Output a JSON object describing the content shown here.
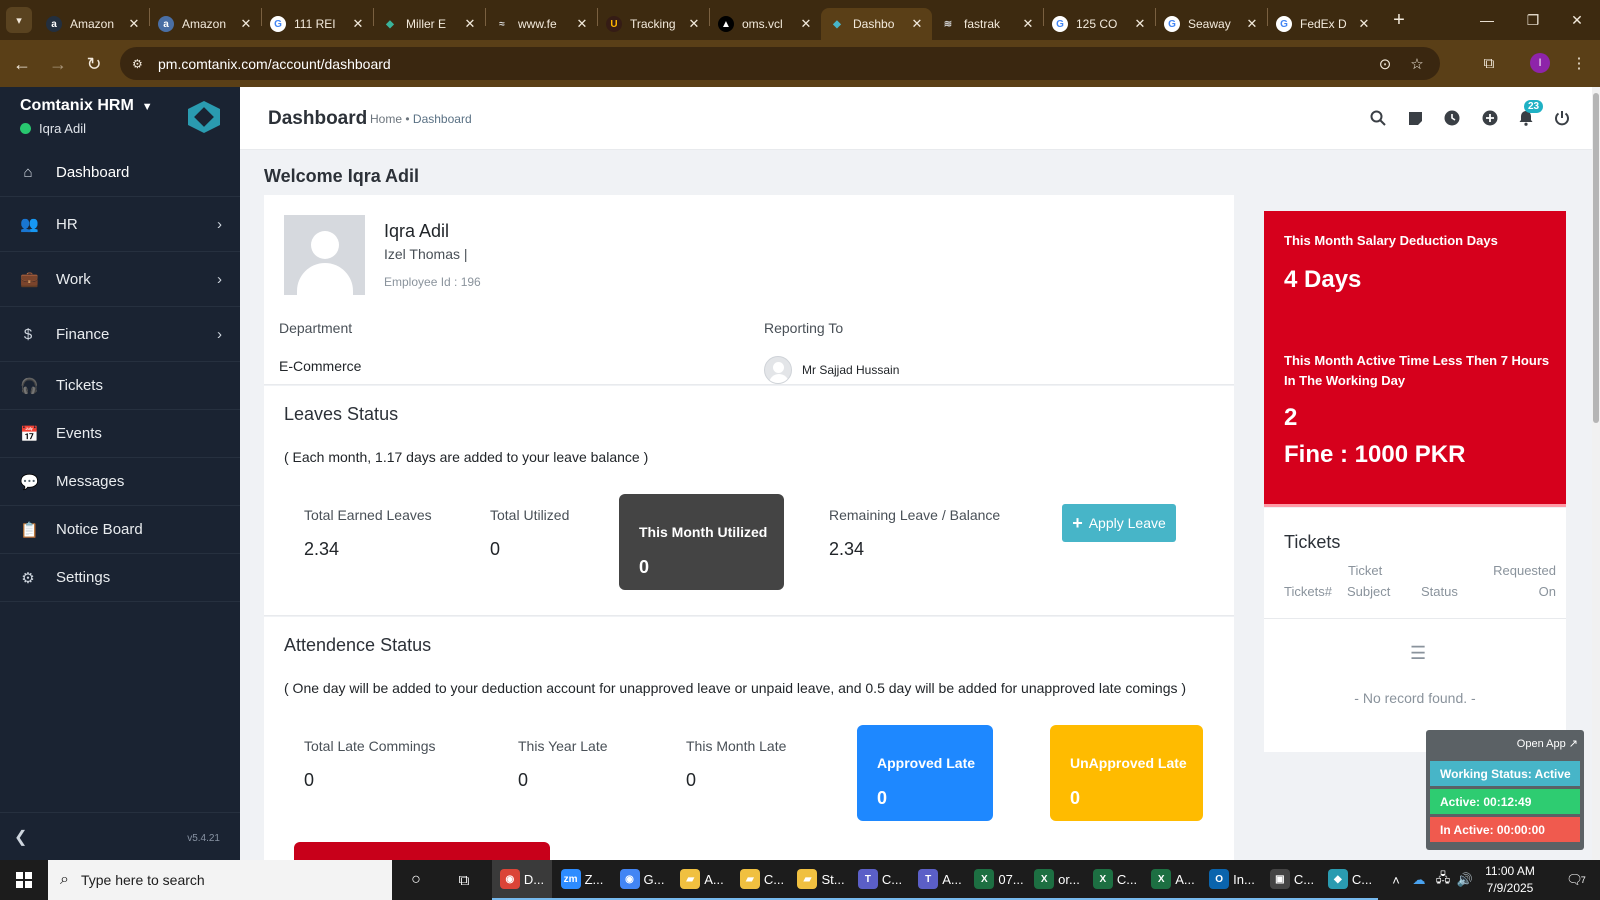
{
  "browser": {
    "tabs": [
      {
        "title": "Amazon",
        "fav": "a",
        "favcolor": "#ffffff",
        "favbg": "#232f3e"
      },
      {
        "title": "Amazon",
        "fav": "a",
        "favcolor": "#ffffff",
        "favbg": "#4a6fa5"
      },
      {
        "title": "111 REI",
        "fav": "G",
        "favcolor": "#4285f4",
        "favbg": "#ffffff"
      },
      {
        "title": "Miller E",
        "fav": "◆",
        "favcolor": "#3ab39a",
        "favbg": "transparent"
      },
      {
        "title": "www.fe",
        "fav": "≈",
        "favcolor": "#dddddd",
        "favbg": "transparent"
      },
      {
        "title": "Tracking",
        "fav": "U",
        "favcolor": "#ffb500",
        "favbg": "#351c15"
      },
      {
        "title": "oms.vcl",
        "fav": "▲",
        "favcolor": "#ffffff",
        "favbg": "#000000"
      },
      {
        "title": "Dashbo",
        "fav": "◆",
        "favcolor": "#47b5c8",
        "favbg": "transparent"
      },
      {
        "title": "fastrak",
        "fav": "≋",
        "favcolor": "#cccccc",
        "favbg": "transparent"
      },
      {
        "title": "125 CO",
        "fav": "G",
        "favcolor": "#4285f4",
        "favbg": "#ffffff"
      },
      {
        "title": "Seaway",
        "fav": "G",
        "favcolor": "#4285f4",
        "favbg": "#ffffff"
      },
      {
        "title": "FedEx D",
        "fav": "G",
        "favcolor": "#4285f4",
        "favbg": "#ffffff"
      }
    ],
    "url": "pm.comtanix.com/account/dashboard",
    "profile_initial": "I"
  },
  "sidebar": {
    "brand": "Comtanix HRM",
    "user": "Iqra Adil",
    "version": "v5.4.21",
    "items": [
      {
        "label": "Dashboard",
        "icon": "⌂",
        "name": "sidebar-item-dashboard",
        "arrow": false
      },
      {
        "label": "HR",
        "icon": "👥",
        "name": "sidebar-item-hr",
        "arrow": true
      },
      {
        "label": "Work",
        "icon": "💼",
        "name": "sidebar-item-work",
        "arrow": true
      },
      {
        "label": "Finance",
        "icon": "$",
        "name": "sidebar-item-finance",
        "arrow": true
      },
      {
        "label": "Tickets",
        "icon": "🎧",
        "name": "sidebar-item-tickets",
        "arrow": false
      },
      {
        "label": "Events",
        "icon": "📅",
        "name": "sidebar-item-events",
        "arrow": false
      },
      {
        "label": "Messages",
        "icon": "💬",
        "name": "sidebar-item-messages",
        "arrow": false
      },
      {
        "label": "Notice Board",
        "icon": "📋",
        "name": "sidebar-item-notice-board",
        "arrow": false
      },
      {
        "label": "Settings",
        "icon": "⚙",
        "name": "sidebar-item-settings",
        "arrow": false
      }
    ]
  },
  "header": {
    "title": "Dashboard",
    "breadcrumb_home": "Home",
    "breadcrumb_sep": "•",
    "breadcrumb_current": "Dashboard",
    "notification_count": "23"
  },
  "welcome": "Welcome Iqra Adil",
  "profile": {
    "name": "Iqra Adil",
    "designation": "Izel Thomas |",
    "employee_id": "Employee Id : 196",
    "department_label": "Department",
    "department": "E-Commerce",
    "reporting_label": "Reporting To",
    "reporting_to": "Mr Sajjad Hussain"
  },
  "leaves": {
    "title": "Leaves Status",
    "note": "( Each month, 1.17 days are added to your leave balance )",
    "total_earned_label": "Total Earned Leaves",
    "total_earned": "2.34",
    "total_utilized_label": "Total Utilized",
    "total_utilized": "0",
    "month_utilized_label": "This Month Utilized",
    "month_utilized": "0",
    "remaining_label": "Remaining Leave / Balance",
    "remaining": "2.34",
    "apply_label": "Apply Leave"
  },
  "attendance": {
    "title": "Attendence Status",
    "note": "( One day will be added to your deduction account for unapproved leave or unpaid leave, and 0.5 day will be added for unapproved late comings )",
    "total_late_label": "Total Late Commings",
    "total_late": "0",
    "year_late_label": "This Year Late",
    "year_late": "0",
    "month_late_label": "This Month Late",
    "month_late": "0",
    "approved_label": "Approved Late",
    "approved": "0",
    "unapproved_label": "UnApproved Late",
    "unapproved": "0"
  },
  "salary": {
    "deduction_label": "This Month Salary Deduction Days",
    "deduction_days": "4 Days",
    "active_label": "This Month Active Time Less Then 7 Hours In The Working Day",
    "active_count": "2",
    "fine": "Fine : 1000 PKR"
  },
  "tickets": {
    "title": "Tickets",
    "col_number": "Tickets#",
    "col_subject_1": "Ticket",
    "col_subject_2": "Subject",
    "col_status": "Status",
    "col_requested_1": "Requested",
    "col_requested_2": "On",
    "empty": "- No record found. -"
  },
  "widget": {
    "open_app": "Open App ↗",
    "working_status": "Working Status: Active",
    "active": "Active: 00:12:49",
    "inactive": "In Active: 00:00:00"
  },
  "taskbar": {
    "search_placeholder": "Type here to search",
    "apps": [
      {
        "label": "D...",
        "glyph": "◉",
        "bg": "#db4437",
        "name": "taskbar-chrome-dashboard",
        "state": "focus"
      },
      {
        "label": "Z...",
        "glyph": "zm",
        "bg": "#2d8cff",
        "name": "taskbar-zoom",
        "state": "run"
      },
      {
        "label": "G...",
        "glyph": "◉",
        "bg": "#4285f4",
        "name": "taskbar-chrome-g",
        "state": "run"
      },
      {
        "label": "A...",
        "glyph": "▰",
        "bg": "#f0c040",
        "name": "taskbar-folder-a",
        "state": "run"
      },
      {
        "label": "C...",
        "glyph": "▰",
        "bg": "#f0c040",
        "name": "taskbar-folder-c",
        "state": "run"
      },
      {
        "label": "St...",
        "glyph": "▰",
        "bg": "#f0c040",
        "name": "taskbar-folder-st",
        "state": "run"
      },
      {
        "label": "C...",
        "glyph": "T",
        "bg": "#5b5fc7",
        "name": "taskbar-teams-c",
        "state": "run"
      },
      {
        "label": "A...",
        "glyph": "T",
        "bg": "#5b5fc7",
        "name": "taskbar-teams-a",
        "state": "run"
      },
      {
        "label": "07...",
        "glyph": "X",
        "bg": "#1d6f42",
        "name": "taskbar-excel-07",
        "state": "run"
      },
      {
        "label": "or...",
        "glyph": "X",
        "bg": "#1d6f42",
        "name": "taskbar-excel-or",
        "state": "run"
      },
      {
        "label": "C...",
        "glyph": "X",
        "bg": "#1d6f42",
        "name": "taskbar-excel-c",
        "state": "run"
      },
      {
        "label": "A...",
        "glyph": "X",
        "bg": "#1d6f42",
        "name": "taskbar-excel-a",
        "state": "run"
      },
      {
        "label": "In...",
        "glyph": "O",
        "bg": "#0a64ad",
        "name": "taskbar-outlook",
        "state": "run"
      },
      {
        "label": "C...",
        "glyph": "▣",
        "bg": "#444444",
        "name": "taskbar-app-c",
        "state": "run"
      },
      {
        "label": "C...",
        "glyph": "◆",
        "bg": "#2a9bb0",
        "name": "taskbar-comtanix",
        "state": "run"
      }
    ],
    "time": "11:00 AM",
    "date": "7/9/2025",
    "notification_count": "7"
  }
}
